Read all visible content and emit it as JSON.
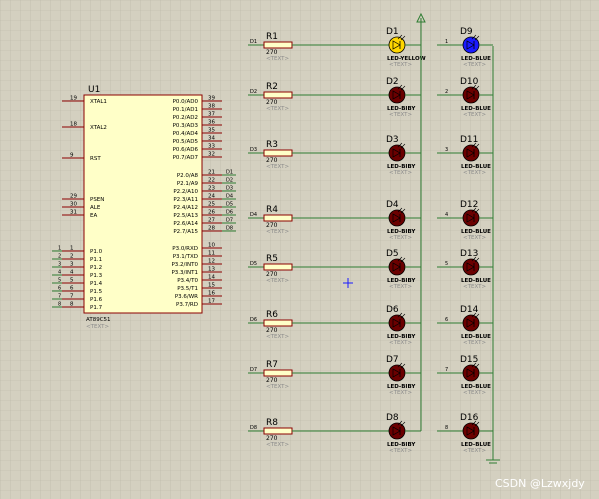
{
  "mcu": {
    "ref": "U1",
    "part": "AT89C51",
    "text": "<TEXT>",
    "left_pins": [
      {
        "num": "19",
        "name": "XTAL1"
      },
      {
        "num": "18",
        "name": "XTAL2"
      },
      {
        "num": "9",
        "name": "RST"
      },
      {
        "num": "29",
        "name": "PSEN"
      },
      {
        "num": "30",
        "name": "ALE"
      },
      {
        "num": "31",
        "name": "EA"
      },
      {
        "num": "1",
        "name": "P1.0"
      },
      {
        "num": "2",
        "name": "P1.1"
      },
      {
        "num": "3",
        "name": "P1.2"
      },
      {
        "num": "4",
        "name": "P1.3"
      },
      {
        "num": "5",
        "name": "P1.4"
      },
      {
        "num": "6",
        "name": "P1.5"
      },
      {
        "num": "7",
        "name": "P1.6"
      },
      {
        "num": "8",
        "name": "P1.7"
      }
    ],
    "right_pins": [
      {
        "num": "39",
        "name": "P0.0/AD0"
      },
      {
        "num": "38",
        "name": "P0.1/AD1"
      },
      {
        "num": "37",
        "name": "P0.2/AD2"
      },
      {
        "num": "36",
        "name": "P0.3/AD3"
      },
      {
        "num": "35",
        "name": "P0.4/AD4"
      },
      {
        "num": "34",
        "name": "P0.5/AD5"
      },
      {
        "num": "33",
        "name": "P0.6/AD6"
      },
      {
        "num": "32",
        "name": "P0.7/AD7"
      },
      {
        "num": "21",
        "name": "P2.0/A8"
      },
      {
        "num": "22",
        "name": "P2.1/A9"
      },
      {
        "num": "23",
        "name": "P2.2/A10"
      },
      {
        "num": "24",
        "name": "P2.3/A11"
      },
      {
        "num": "25",
        "name": "P2.4/A12"
      },
      {
        "num": "26",
        "name": "P2.5/A13"
      },
      {
        "num": "27",
        "name": "P2.6/A14"
      },
      {
        "num": "28",
        "name": "P2.7/A15"
      },
      {
        "num": "10",
        "name": "P3.0/RXD"
      },
      {
        "num": "11",
        "name": "P3.1/TXD"
      },
      {
        "num": "12",
        "name": "P3.2/INT0"
      },
      {
        "num": "13",
        "name": "P3.3/INT1"
      },
      {
        "num": "14",
        "name": "P3.4/T0"
      },
      {
        "num": "15",
        "name": "P3.5/T1"
      },
      {
        "num": "16",
        "name": "P3.6/WR"
      },
      {
        "num": "17",
        "name": "P3.7/RD"
      }
    ],
    "p1_nets": [
      "1",
      "2",
      "3",
      "4",
      "5",
      "6",
      "7",
      "8"
    ],
    "p2_nets": [
      "D1",
      "D2",
      "D3",
      "D4",
      "D5",
      "D6",
      "D7",
      "D8"
    ]
  },
  "rows": [
    {
      "net": "D1",
      "res": "R1",
      "val": "270",
      "led": "D1",
      "led_type": "LED-YELLOW",
      "right_net": "1",
      "right_led": "D9",
      "right_type": "LED-BLUE"
    },
    {
      "net": "D2",
      "res": "R2",
      "val": "270",
      "led": "D2",
      "led_type": "LED-BIBY",
      "right_net": "2",
      "right_led": "D10",
      "right_type": "LED-BLUE"
    },
    {
      "net": "D3",
      "res": "R3",
      "val": "270",
      "led": "D3",
      "led_type": "LED-BIBY",
      "right_net": "3",
      "right_led": "D11",
      "right_type": "LED-BLUE"
    },
    {
      "net": "D4",
      "res": "R4",
      "val": "270",
      "led": "D4",
      "led_type": "LED-BIBY",
      "right_net": "4",
      "right_led": "D12",
      "right_type": "LED-BLUE"
    },
    {
      "net": "D5",
      "res": "R5",
      "val": "270",
      "led": "D5",
      "led_type": "LED-BIBY",
      "right_net": "5",
      "right_led": "D13",
      "right_type": "LED-BLUE"
    },
    {
      "net": "D6",
      "res": "R6",
      "val": "270",
      "led": "D6",
      "led_type": "LED-BIBY",
      "right_net": "6",
      "right_led": "D14",
      "right_type": "LED-BLUE"
    },
    {
      "net": "D7",
      "res": "R7",
      "val": "270",
      "led": "D7",
      "led_type": "LED-BIBY",
      "right_net": "7",
      "right_led": "D15",
      "right_type": "LED-BLUE"
    },
    {
      "net": "D8",
      "res": "R8",
      "val": "270",
      "led": "D8",
      "led_type": "LED-BIBY",
      "right_net": "8",
      "right_led": "D16",
      "right_type": "LED-BLUE"
    }
  ],
  "text_placeholder": "<TEXT>",
  "watermark": "CSDN @Lzwxjdy",
  "colors": {
    "background": "#d4d0c0",
    "grid": "#b9b5a6",
    "wire": "#2e7d32",
    "component": "#8b0000",
    "chip_fill": "#ffffc8",
    "led_red": "#6b0000",
    "led_yellow": "#ffd700",
    "led_blue": "#1a1aff",
    "power": "#2e7d32"
  }
}
